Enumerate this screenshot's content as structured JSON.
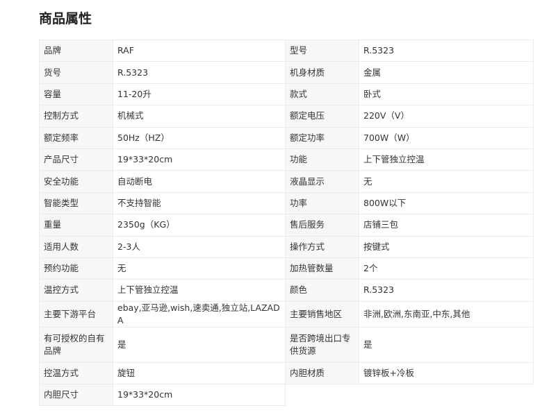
{
  "title": "商品属性",
  "rows": [
    {
      "k1": "品牌",
      "v1": "RAF",
      "k2": "型号",
      "v2": "R.5323"
    },
    {
      "k1": "货号",
      "v1": "R.5323",
      "k2": "机身材质",
      "v2": "金属"
    },
    {
      "k1": "容量",
      "v1": "11-20升",
      "k2": "款式",
      "v2": "卧式"
    },
    {
      "k1": "控制方式",
      "v1": "机械式",
      "k2": "额定电压",
      "v2": "220V（V）"
    },
    {
      "k1": "额定频率",
      "v1": "50Hz（HZ）",
      "k2": "额定功率",
      "v2": "700W（W）"
    },
    {
      "k1": "产品尺寸",
      "v1": "19*33*20cm",
      "k2": "功能",
      "v2": "上下管独立控温"
    },
    {
      "k1": "安全功能",
      "v1": "自动断电",
      "k2": "液晶显示",
      "v2": "无"
    },
    {
      "k1": "智能类型",
      "v1": "不支持智能",
      "k2": "功率",
      "v2": "800W以下"
    },
    {
      "k1": "重量",
      "v1": "2350g（KG）",
      "k2": "售后服务",
      "v2": "店铺三包"
    },
    {
      "k1": "适用人数",
      "v1": "2-3人",
      "k2": "操作方式",
      "v2": "按键式"
    },
    {
      "k1": "预约功能",
      "v1": "无",
      "k2": "加热管数量",
      "v2": "2个"
    },
    {
      "k1": "温控方式",
      "v1": "上下管独立控温",
      "k2": "颜色",
      "v2": "R.5323"
    },
    {
      "k1": "主要下游平台",
      "v1": "ebay,亚马逊,wish,速卖通,独立站,LAZADA",
      "k2": "主要销售地区",
      "v2": "非洲,欧洲,东南亚,中东,其他"
    },
    {
      "k1": "有可授权的自有品牌",
      "v1": "是",
      "k2": "是否跨境出口专供货源",
      "v2": "是"
    },
    {
      "k1": "控温方式",
      "v1": "旋钮",
      "k2": "内胆材质",
      "v2": "镀锌板+冷板"
    },
    {
      "k1": "内胆尺寸",
      "v1": "19*33*20cm"
    }
  ]
}
